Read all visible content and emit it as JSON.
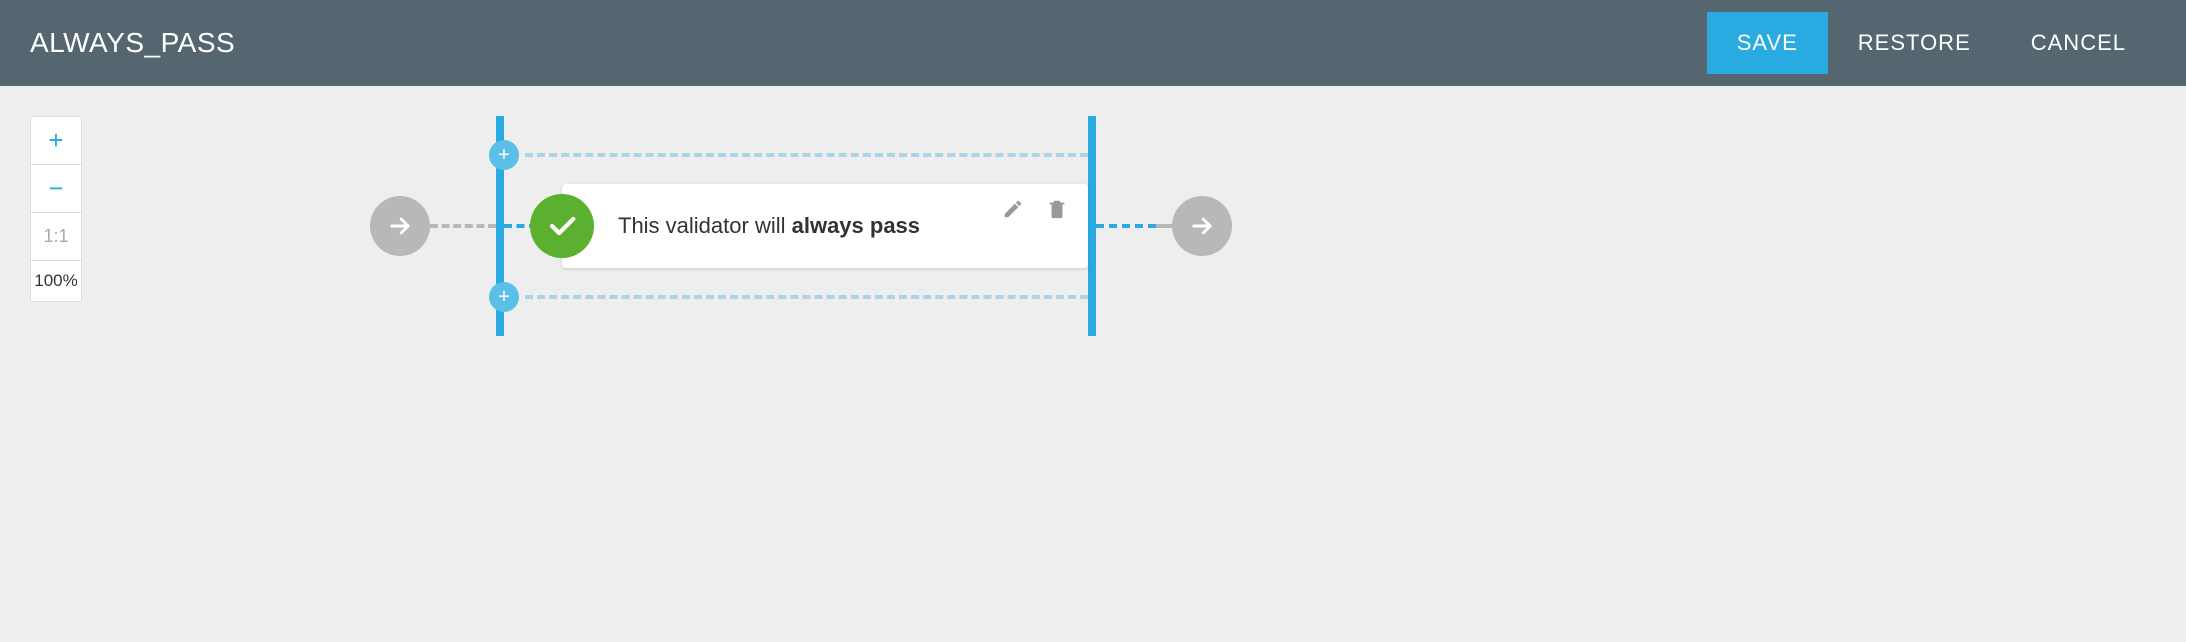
{
  "header": {
    "title": "ALWAYS_PASS",
    "save": "SAVE",
    "restore": "RESTORE",
    "cancel": "CANCEL"
  },
  "zoom": {
    "plus": "+",
    "minus": "−",
    "ratio": "1:1",
    "percent": "100%"
  },
  "validator": {
    "badge_icon": "check-icon",
    "text_prefix": "This validator will ",
    "text_bold": "always pass",
    "add_icon": "+"
  }
}
